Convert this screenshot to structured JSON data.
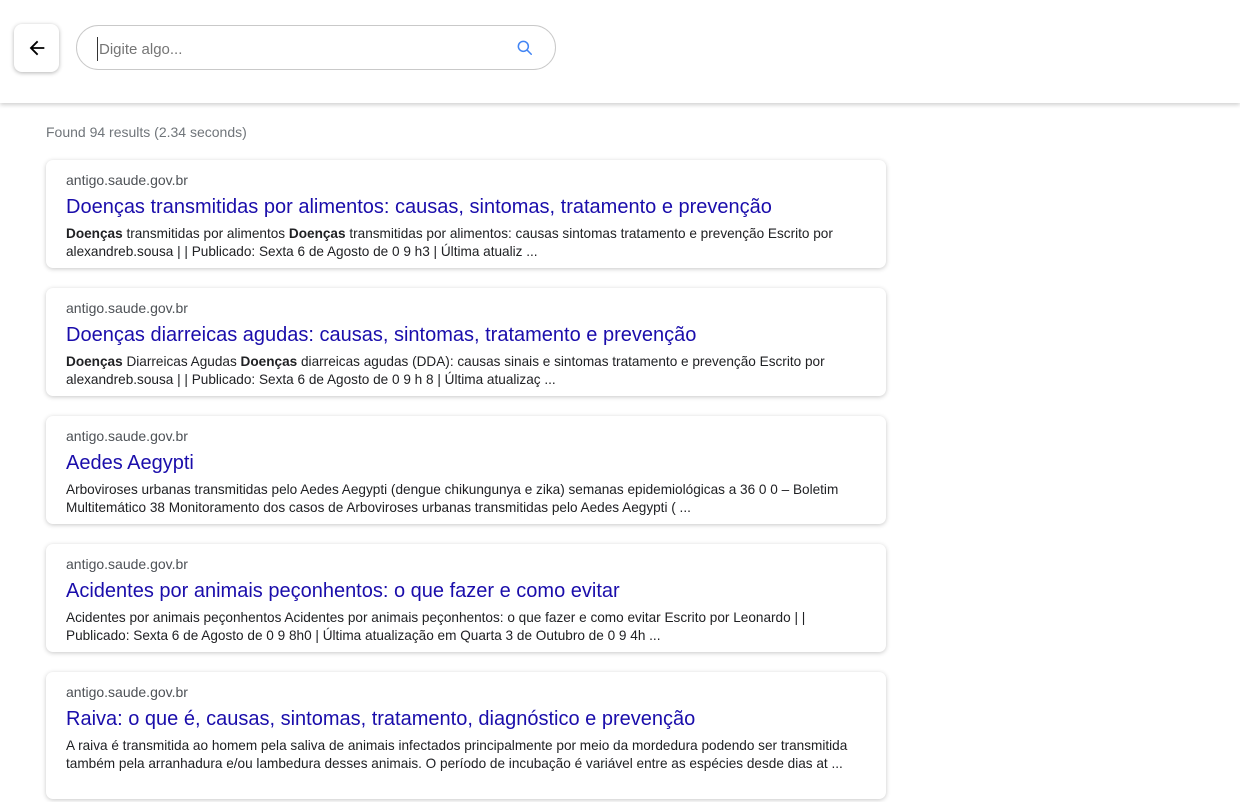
{
  "header": {
    "back_label": "←",
    "search": {
      "value": "",
      "placeholder": "Digite algo..."
    }
  },
  "results_stats": "Found 94 results (2.34 seconds)",
  "colors": {
    "link": "#1a0dab",
    "domain": "#4d5156",
    "stats": "#70757a",
    "search_icon": "#4285f4"
  },
  "results": [
    {
      "domain": "antigo.saude.gov.br",
      "title": "Doenças transmitidas por alimentos: causas, sintomas, tratamento e prevenção",
      "snippet": [
        {
          "text": "Doenças",
          "bold": true
        },
        {
          "text": " transmitidas por alimentos ",
          "bold": false
        },
        {
          "text": "Doenças",
          "bold": true
        },
        {
          "text": " transmitidas por alimentos: causas sintomas tratamento e prevenção Escrito por alexandreb.sousa | | Publicado: Sexta 6 de Agosto de 0 9 h3 | Última atualiz ...",
          "bold": false
        }
      ]
    },
    {
      "domain": "antigo.saude.gov.br",
      "title": "Doenças diarreicas agudas: causas, sintomas, tratamento e prevenção",
      "snippet": [
        {
          "text": "Doenças",
          "bold": true
        },
        {
          "text": " Diarreicas Agudas ",
          "bold": false
        },
        {
          "text": "Doenças",
          "bold": true
        },
        {
          "text": " diarreicas agudas (DDA): causas sinais e sintomas tratamento e prevenção Escrito por alexandreb.sousa | | Publicado: Sexta 6 de Agosto de 0 9 h 8 | Última atualizaç ...",
          "bold": false
        }
      ]
    },
    {
      "domain": "antigo.saude.gov.br",
      "title": "Aedes Aegypti",
      "snippet": [
        {
          "text": "Arboviroses urbanas transmitidas pelo Aedes Aegypti (dengue chikungunya e zika) semanas epidemiológicas a 36 0 0 – Boletim Multitemático 38 Monitoramento dos casos de Arboviroses urbanas transmitidas pelo Aedes Aegypti ( ...",
          "bold": false
        }
      ]
    },
    {
      "domain": "antigo.saude.gov.br",
      "title": "Acidentes por animais peçonhentos: o que fazer e como evitar",
      "snippet": [
        {
          "text": "Acidentes por animais peçonhentos Acidentes por animais peçonhentos: o que fazer e como evitar Escrito por Leonardo | | Publicado: Sexta 6 de Agosto de 0 9 8h0 | Última atualização em Quarta 3 de Outubro de 0 9 4h ...",
          "bold": false
        }
      ]
    },
    {
      "domain": "antigo.saude.gov.br",
      "title": "Raiva: o que é, causas, sintomas, tratamento, diagnóstico e prevenção",
      "snippet": [
        {
          "text": "A raiva é transmitida ao homem pela saliva de animais infectados principalmente por meio da mordedura podendo ser transmitida também pela arranhadura e/ou lambedura desses animais. O período de incubação é variável entre as espécies desde dias at ...",
          "bold": false
        }
      ]
    }
  ]
}
